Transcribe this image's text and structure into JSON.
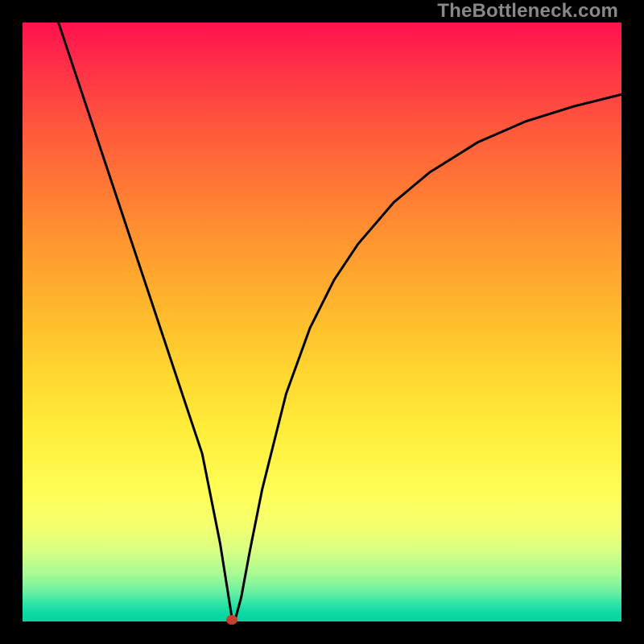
{
  "watermark": "TheBottleneck.com",
  "colors": {
    "frame": "#000000",
    "curve": "#000000",
    "marker": "#c44030",
    "watermark": "#888888"
  },
  "chart_data": {
    "type": "line",
    "title": "",
    "xlabel": "",
    "ylabel": "",
    "xlim": [
      0,
      100
    ],
    "ylim": [
      0,
      100
    ],
    "grid": false,
    "legend": false,
    "series": [
      {
        "name": "bottleneck-curve",
        "x": [
          6,
          10,
          14,
          18,
          22,
          26,
          30,
          33,
          34.5,
          35,
          35.5,
          36.5,
          38,
          40,
          44,
          48,
          52,
          56,
          62,
          68,
          76,
          84,
          92,
          100
        ],
        "y": [
          100,
          88,
          76,
          64,
          52,
          40,
          28,
          13,
          3.5,
          0.3,
          0.3,
          4,
          12,
          22,
          38,
          49,
          57,
          63,
          70,
          75,
          80,
          83.5,
          86,
          88
        ]
      }
    ],
    "annotations": [
      {
        "name": "min-marker",
        "x": 35,
        "y": 0.3
      }
    ],
    "background_gradient": {
      "direction": "top-to-bottom",
      "stops": [
        {
          "pos": 0.0,
          "color": "#ff124d"
        },
        {
          "pos": 0.18,
          "color": "#ff5a3c"
        },
        {
          "pos": 0.38,
          "color": "#ff9a2f"
        },
        {
          "pos": 0.58,
          "color": "#ffd52f"
        },
        {
          "pos": 0.78,
          "color": "#fffd55"
        },
        {
          "pos": 0.92,
          "color": "#a9fa93"
        },
        {
          "pos": 1.0,
          "color": "#06d39e"
        }
      ]
    }
  }
}
